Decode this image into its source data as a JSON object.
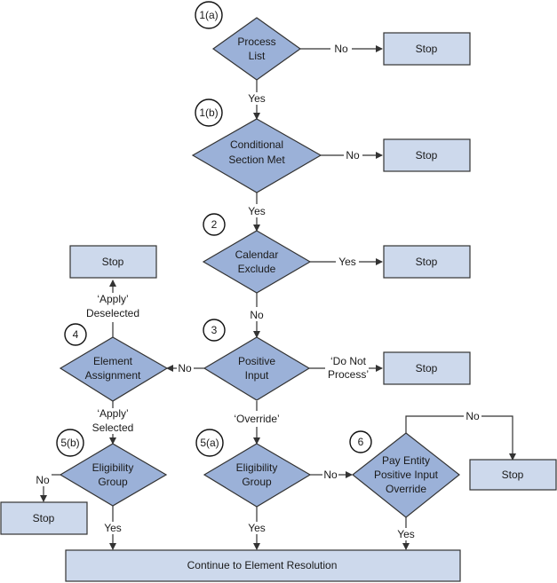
{
  "colors": {
    "decision_fill": "#9bb1d8",
    "terminal_fill": "#cdd9ec",
    "stroke": "#333333"
  },
  "steps": {
    "s1a": "1(a)",
    "s1b": "1(b)",
    "s2": "2",
    "s3": "3",
    "s4": "4",
    "s5a": "5(a)",
    "s5b": "5(b)",
    "s6": "6"
  },
  "decisions": {
    "process_list": [
      "Process",
      "List"
    ],
    "conditional_section": [
      "Conditional",
      "Section Met"
    ],
    "calendar_exclude": [
      "Calendar",
      "Exclude"
    ],
    "positive_input": [
      "Positive",
      "Input"
    ],
    "element_assignment": [
      "Element",
      "Assignment"
    ],
    "eligibility_group_a": [
      "Eligibility",
      "Group"
    ],
    "eligibility_group_b": [
      "Eligibility",
      "Group"
    ],
    "pay_entity_override": [
      "Pay Entity",
      "Positive Input",
      "Override"
    ]
  },
  "terminals": {
    "stop": "Stop",
    "continue": "Continue to Element Resolution"
  },
  "edge_labels": {
    "yes": "Yes",
    "no": "No",
    "apply": "‘Apply’",
    "deselected": "Deselected",
    "selected": "Selected",
    "do_not": "‘Do Not",
    "process": "Process’",
    "override": "‘Override’"
  }
}
